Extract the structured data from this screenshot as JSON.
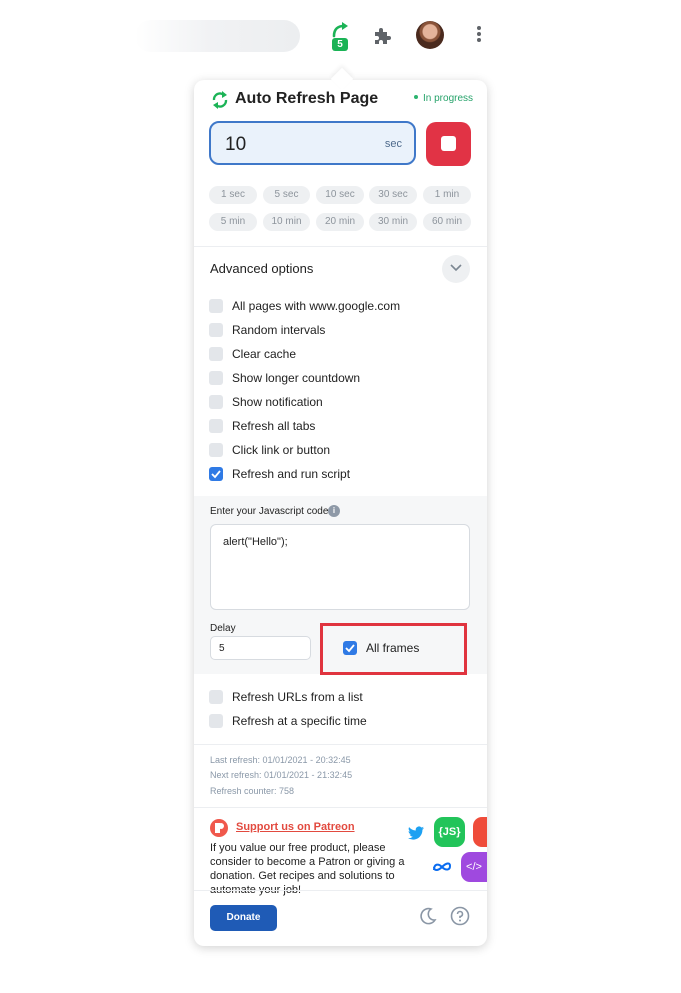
{
  "extension": {
    "title": "Auto Refresh Page",
    "status": "In progress",
    "badge_count": "5"
  },
  "interval": {
    "value": "10",
    "unit": "sec"
  },
  "presets": [
    "1 sec",
    "5 sec",
    "10 sec",
    "30 sec",
    "1 min",
    "5 min",
    "10 min",
    "20 min",
    "30 min",
    "60 min"
  ],
  "advanced": {
    "title": "Advanced options",
    "options": [
      {
        "label": "All pages with www.google.com",
        "checked": false
      },
      {
        "label": "Random intervals",
        "checked": false
      },
      {
        "label": "Clear cache",
        "checked": false
      },
      {
        "label": "Show longer countdown",
        "checked": false
      },
      {
        "label": "Show notification",
        "checked": false
      },
      {
        "label": "Refresh all tabs",
        "checked": false
      },
      {
        "label": "Click link or button",
        "checked": false
      },
      {
        "label": "Refresh and run script",
        "checked": true
      }
    ],
    "script": {
      "code_label": "Enter your Javascript code",
      "code": "alert(\"Hello\");",
      "delay_label": "Delay",
      "delay_value": "5",
      "all_frames_label": "All frames",
      "all_frames_checked": true
    },
    "more_options": [
      {
        "label": "Refresh URLs from a list",
        "checked": false
      },
      {
        "label": "Refresh at a specific time",
        "checked": false
      }
    ]
  },
  "info": {
    "last_refresh": "Last refresh: 01/01/2021 - 20:32:45",
    "next_refresh": "Next refresh: 01/01/2021 - 21:32:45",
    "counter": "Refresh counter: 758"
  },
  "patreon": {
    "link": "Support us on Patreon",
    "text": "If you value our free product, please consider to become a Patron or giving a donation. Get recipes and solutions to automate your job!"
  },
  "promo": {
    "js_badge": "{JS}",
    "code_badge": "</>"
  },
  "footer": {
    "donate": "Donate"
  },
  "colors": {
    "accent": "#2f7ae5",
    "stop": "#e13345",
    "success": "#1bb356",
    "highlight": "#e0343f"
  }
}
